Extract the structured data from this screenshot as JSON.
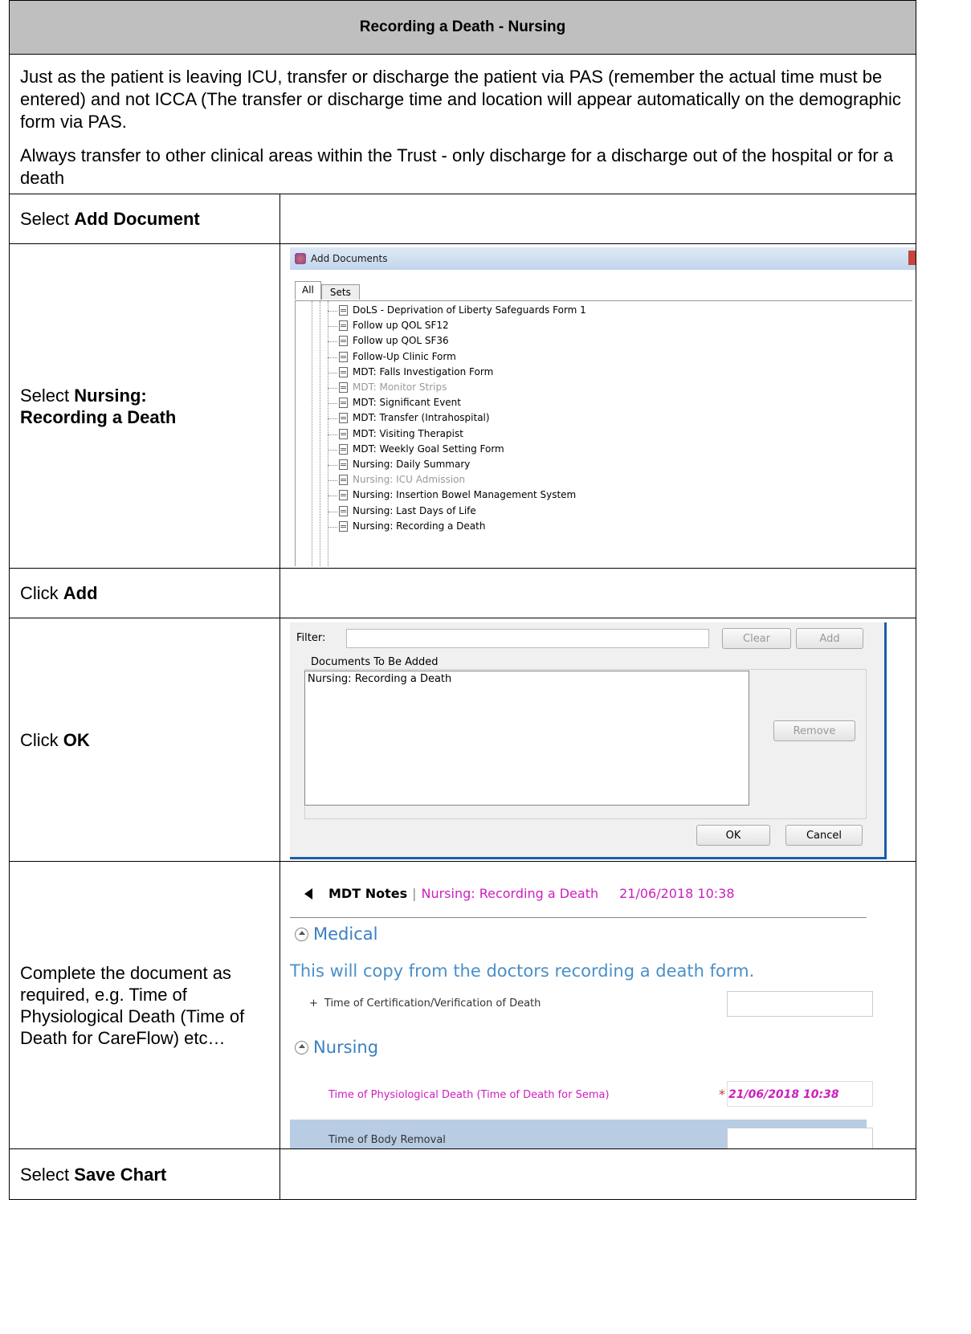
{
  "header": {
    "title": "Recording a Death - Nursing"
  },
  "intro": {
    "para1": "Just as the patient is leaving ICU, transfer or discharge the patient via PAS (remember the actual time must be entered) and not ICCA (The transfer or discharge time and location will appear automatically on the demographic form via PAS.",
    "para2": "Always transfer to other clinical areas within the Trust - only discharge for a discharge out of the hospital or for a death"
  },
  "steps": {
    "s1": {
      "prefix": "Select ",
      "bold": "Add Document"
    },
    "s2": {
      "prefix": "Select ",
      "bold": "Nursing: Recording a Death"
    },
    "s3": {
      "prefix": "Click ",
      "bold": "Add"
    },
    "s4": {
      "prefix": "Click ",
      "bold": "OK"
    },
    "s5": {
      "text": "Complete the document as required, e.g. Time of Physiological Death (Time of Death for CareFlow) etc…"
    },
    "s6": {
      "prefix": "Select ",
      "bold": "Save Chart"
    }
  },
  "add_documents": {
    "window_title": "Add Documents",
    "tab_all": "All",
    "tab_sets": "Sets",
    "items": [
      {
        "label": "DoLS - Deprivation of Liberty Safeguards Form 1",
        "grey": false
      },
      {
        "label": "Follow up QOL SF12",
        "grey": false
      },
      {
        "label": "Follow up QOL SF36",
        "grey": false
      },
      {
        "label": "Follow-Up Clinic Form",
        "grey": false
      },
      {
        "label": "MDT: Falls Investigation Form",
        "grey": false
      },
      {
        "label": "MDT: Monitor Strips",
        "grey": true
      },
      {
        "label": "MDT: Significant Event",
        "grey": false
      },
      {
        "label": "MDT: Transfer (Intrahospital)",
        "grey": false
      },
      {
        "label": "MDT: Visiting Therapist",
        "grey": false
      },
      {
        "label": "MDT: Weekly Goal Setting Form",
        "grey": false
      },
      {
        "label": "Nursing: Daily Summary",
        "grey": false
      },
      {
        "label": "Nursing: ICU Admission",
        "grey": true
      },
      {
        "label": "Nursing: Insertion Bowel Management System",
        "grey": false
      },
      {
        "label": "Nursing: Last Days of Life",
        "grey": false
      },
      {
        "label": "Nursing: Recording a Death",
        "grey": false
      }
    ]
  },
  "filter_dialog": {
    "filter_label": "Filter:",
    "filter_value": "",
    "clear_label": "Clear",
    "add_label": "Add",
    "group_label": "Documents To Be Added",
    "added_item": "Nursing: Recording a Death",
    "remove_label": "Remove",
    "ok_label": "OK",
    "cancel_label": "Cancel"
  },
  "mdt_form": {
    "title": "MDT Notes",
    "separator": "|",
    "doc_name": "Nursing: Recording a Death",
    "datetime": "21/06/2018 10:38",
    "medical_heading": "Medical",
    "copy_note": "This will copy from the doctors recording a death form.",
    "certification_label": "Time of Certification/Verification of Death",
    "certification_value": "",
    "nursing_heading": "Nursing",
    "physio_label": "Time of Physiological Death (Time of Death for Sema)",
    "physio_required": "*",
    "physio_value": "21/06/2018 10:38",
    "body_removal_label": "Time of Body Removal",
    "body_removal_value": ""
  },
  "colors": {
    "header_bg": "#bfbfbf",
    "pink": "#cc1fbf",
    "section_blue": "#3a7fc1",
    "highlight_row": "#b8cce4"
  }
}
